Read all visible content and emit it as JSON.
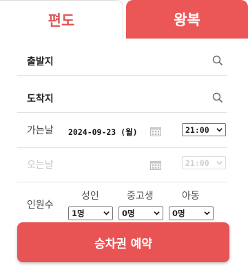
{
  "tabs": {
    "oneway": "편도",
    "roundtrip": "왕복"
  },
  "departure": {
    "label": "출발지",
    "icon": "search-icon"
  },
  "arrival": {
    "label": "도착지",
    "icon": "search-icon"
  },
  "outbound": {
    "label": "가는날",
    "date": "2024-09-23 (월)",
    "time": "21:00"
  },
  "return": {
    "label": "오는날",
    "time": "21:00"
  },
  "passengers": {
    "label": "인원수",
    "adult": {
      "label": "성인",
      "value": "1명"
    },
    "youth": {
      "label": "중고생",
      "value": "0명"
    },
    "child": {
      "label": "아동",
      "value": "0명"
    }
  },
  "book_button": "승차권 예약",
  "colors": {
    "accent": "#eb5757",
    "tab_active_text": "#e05555"
  }
}
